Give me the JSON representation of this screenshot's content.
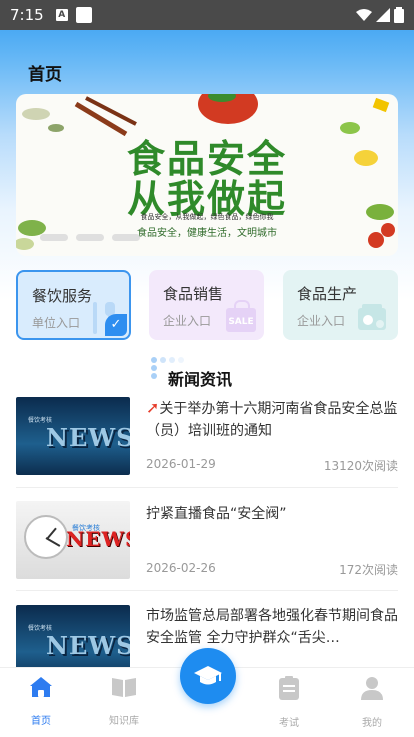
{
  "status_bar": {
    "time": "7:15",
    "notif_letter": "A"
  },
  "header": {
    "title": "首页"
  },
  "banner": {
    "line1": "食品安全",
    "line2": "从我做起",
    "sub1": "食品安全，从我做起，绿色食品，绿色你我",
    "sub2": "食品安全，健康生活，文明城市"
  },
  "services": [
    {
      "name": "餐饮服务",
      "sub": "单位入口",
      "selected": true
    },
    {
      "name": "食品销售",
      "sub": "企业入口",
      "tag": "SALE"
    },
    {
      "name": "食品生产",
      "sub": "企业入口"
    }
  ],
  "news_section": {
    "title": "新闻资讯"
  },
  "news": [
    {
      "title": "关于举办第十六期河南省食品安全总监（员）培训班的通知",
      "date": "2026-01-29",
      "reads": "13120次阅读",
      "thumb_word": "NEWS",
      "thumb_tag": "餐饮考核",
      "hot": true
    },
    {
      "title": "拧紧直播食品“安全阀”",
      "date": "2026-02-26",
      "reads": "172次阅读",
      "thumb_word": "NEWS",
      "thumb_tag": "餐饮考核"
    },
    {
      "title": "市场监管总局部署各地强化春节期间食品安全监管 全力守护群众“舌尖…",
      "date": "",
      "reads": "",
      "thumb_word": "NEWS",
      "thumb_tag": "餐饮考核"
    }
  ],
  "tabbar": {
    "items": [
      {
        "label": "首页",
        "icon": "home-icon",
        "active": true
      },
      {
        "label": "知识库",
        "icon": "book-icon"
      },
      {
        "label": "",
        "icon": "graduation-cap-icon"
      },
      {
        "label": "考试",
        "icon": "clipboard-icon"
      },
      {
        "label": "我的",
        "icon": "person-icon"
      }
    ]
  },
  "colors": {
    "accent": "#1e8cf0",
    "header_gradient_top": "#2f9bf0",
    "banner_green": "#2f8a2a",
    "hot_red": "#e63c2a"
  }
}
